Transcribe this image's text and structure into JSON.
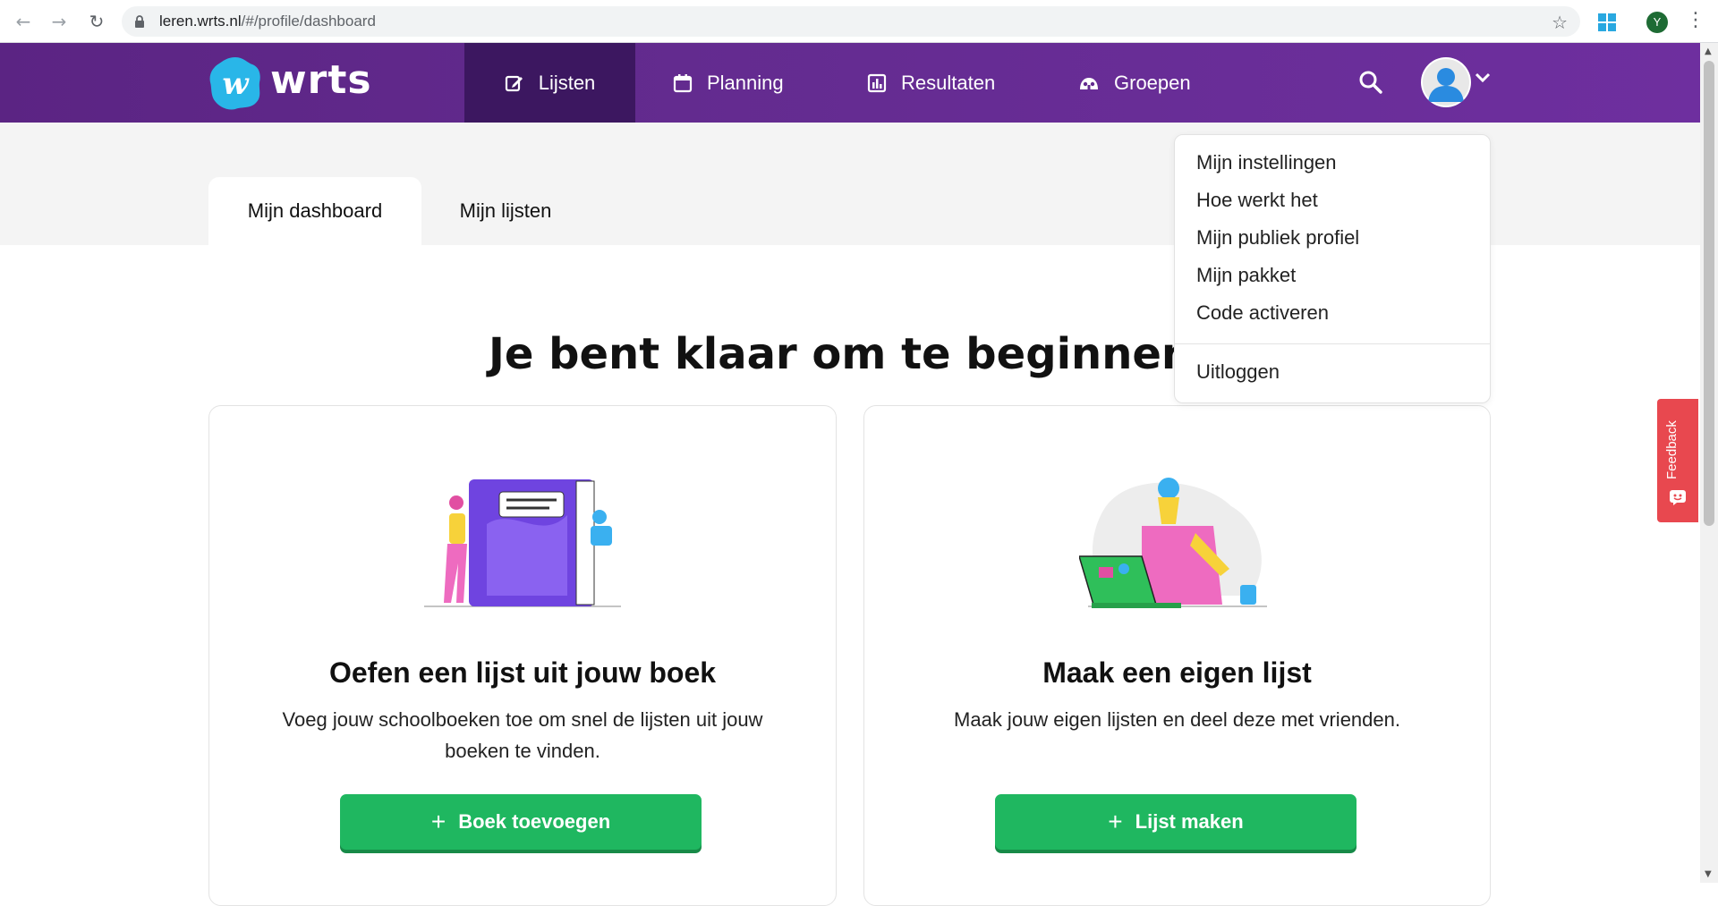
{
  "browser": {
    "url_host": "leren.wrts.nl",
    "url_path": "/#/profile/dashboard",
    "profile_initial": "Y"
  },
  "header": {
    "logo_text": "wrts",
    "nav": [
      {
        "label": "Lijsten",
        "icon": "edit-icon",
        "active": true
      },
      {
        "label": "Planning",
        "icon": "calendar-icon",
        "active": false
      },
      {
        "label": "Resultaten",
        "icon": "chart-icon",
        "active": false
      },
      {
        "label": "Groepen",
        "icon": "group-icon",
        "active": false
      }
    ]
  },
  "tabs": [
    {
      "label": "Mijn dashboard",
      "active": true
    },
    {
      "label": "Mijn lijsten",
      "active": false
    }
  ],
  "main": {
    "headline": "Je bent klaar om te beginnen!",
    "cards": [
      {
        "title": "Oefen een lijst uit jouw boek",
        "description": "Voeg jouw schoolboeken toe om snel de lijsten uit jouw boeken te vinden.",
        "button": "Boek toevoegen"
      },
      {
        "title": "Maak een eigen lijst",
        "description": "Maak jouw eigen lijsten en deel deze met vrienden.",
        "button": "Lijst maken"
      }
    ]
  },
  "dropdown": {
    "items": [
      "Mijn instellingen",
      "Hoe werkt het",
      "Mijn publiek profiel",
      "Mijn pakket",
      "Code activeren"
    ],
    "logout": "Uitloggen"
  },
  "feedback_label": "Feedback",
  "colors": {
    "header_purple": "#632b8f",
    "active_nav": "#3c1760",
    "button_green": "#1fb760",
    "feedback_red": "#e8484f"
  }
}
